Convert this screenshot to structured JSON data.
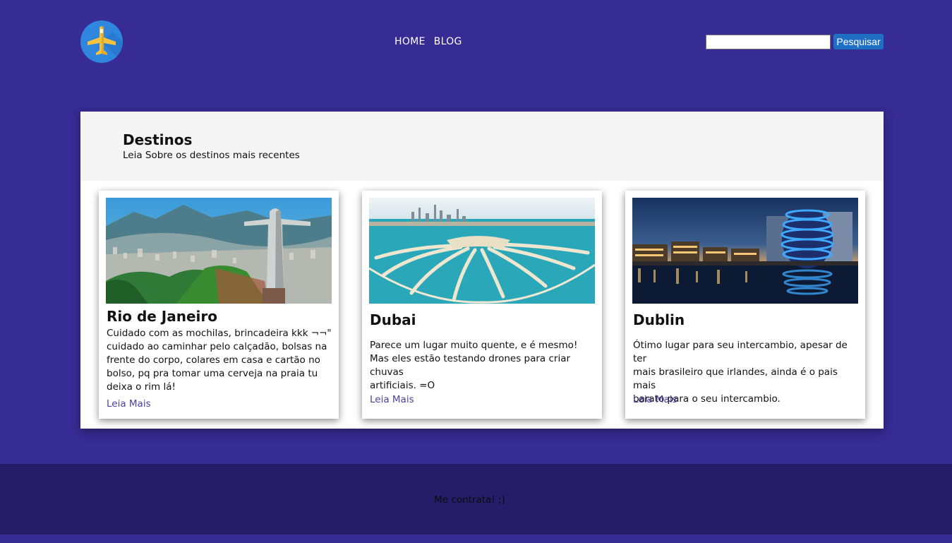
{
  "header": {
    "logo_icon": "airplane-icon",
    "nav": [
      "HOME",
      "BLOG"
    ],
    "search": {
      "value": "",
      "placeholder": ""
    },
    "search_button": "Pesquisar"
  },
  "destinations": {
    "title": "Destinos",
    "subtitle": "Leia Sobre os destinos mais recentes",
    "cards": [
      {
        "title": "Rio de Janeiro",
        "text": "Cuidado com as mochilas, brincadeira kkk ¬¬\"\ncuidado ao caminhar pelo calçadão, bolsas na\nfrente do corpo, colares em casa e cartão no\nbolso, pq pra tomar uma cerveja na praia tu\ndeixa o rim lá!",
        "link": "Leia Mais"
      },
      {
        "title": "Dubai",
        "text": "Parece um lugar muito quente, e é mesmo!\nMas eles estão testando drones para criar chuvas\nartificiais. =O",
        "link": "Leia Mais"
      },
      {
        "title": "Dublin",
        "text": "Ótimo lugar para seu intercambio, apesar de ter\nmais brasileiro que irlandes, ainda é o pais mais\nbarato para o seu intercambio.",
        "link": "Leia Mais"
      }
    ]
  },
  "footer": {
    "text": "Me contrata! ;)"
  },
  "colors": {
    "background": "#372b94",
    "footer": "#251d68",
    "button": "#1f6fc4",
    "link": "#4b3fa0"
  }
}
